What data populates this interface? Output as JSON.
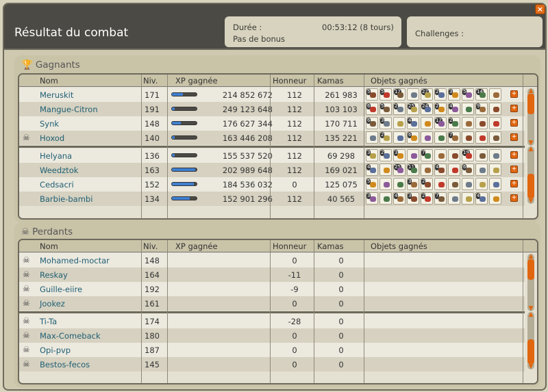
{
  "window": {
    "title": "Résultat du combat",
    "close_icon": "close-icon"
  },
  "info": {
    "duree_label": "Durée :",
    "duree_value": "00:53:12 (8 tours)",
    "bonus": "Pas de bonus",
    "challenges_label": "Challenges :"
  },
  "columns": {
    "nom": "Nom",
    "niv": "Niv.",
    "xp": "XP gagnée",
    "honneur": "Honneur",
    "kamas": "Kamas",
    "objets": "Objets gagnés"
  },
  "winners": {
    "title": "Gagnants",
    "rows": [
      {
        "name": "Meruskit",
        "level": "171",
        "xp": "214 852 672",
        "xp_fill": 0.45,
        "honneur": "112",
        "kamas": "261 983",
        "dead": false
      },
      {
        "name": "Mangue-Citron",
        "level": "191",
        "xp": "249 123 648",
        "xp_fill": 0.1,
        "honneur": "112",
        "kamas": "103 103",
        "dead": false
      },
      {
        "name": "Synk",
        "level": "148",
        "xp": "176 627 344",
        "xp_fill": 0.35,
        "honneur": "112",
        "kamas": "170 711",
        "dead": false
      },
      {
        "name": "Hoxod",
        "level": "140",
        "xp": "163 446 208",
        "xp_fill": 0.12,
        "honneur": "112",
        "kamas": "135 221",
        "dead": true
      },
      {
        "name": "Helyana",
        "level": "136",
        "xp": "155 537 520",
        "xp_fill": 0.12,
        "honneur": "112",
        "kamas": "69 298",
        "dead": false
      },
      {
        "name": "Weedztok",
        "level": "163",
        "xp": "202 989 648",
        "xp_fill": 0.95,
        "honneur": "112",
        "kamas": "169 021",
        "dead": false
      },
      {
        "name": "Cedsacri",
        "level": "152",
        "xp": "184 536 032",
        "xp_fill": 0.9,
        "honneur": "0",
        "kamas": "125 075",
        "dead": false
      },
      {
        "name": "Barbie-bambi",
        "level": "134",
        "xp": "152 901 296",
        "xp_fill": 0.72,
        "honneur": "112",
        "kamas": "40 565",
        "dead": false
      }
    ]
  },
  "losers": {
    "title": "Perdants",
    "rows": [
      {
        "name": "Mohamed-moctar",
        "level": "148",
        "honneur": "0",
        "kamas": "0"
      },
      {
        "name": "Reskay",
        "level": "164",
        "honneur": "-11",
        "kamas": "0"
      },
      {
        "name": "Guille-eiire",
        "level": "192",
        "honneur": "-9",
        "kamas": "0"
      },
      {
        "name": "Jookez",
        "level": "161",
        "honneur": "0",
        "kamas": "0"
      },
      {
        "name": "Ti-Ta",
        "level": "174",
        "honneur": "-28",
        "kamas": "0"
      },
      {
        "name": "Max-Comeback",
        "level": "180",
        "honneur": "0",
        "kamas": "0"
      },
      {
        "name": "Opi-pvp",
        "level": "187",
        "honneur": "0",
        "kamas": "0"
      },
      {
        "name": "Bestos-fecos",
        "level": "145",
        "honneur": "0",
        "kamas": "0"
      }
    ]
  },
  "item_badges": [
    [
      "5",
      "5",
      "12",
      "",
      "22",
      "2",
      "3",
      "5",
      "14",
      ""
    ],
    [
      "6",
      "5",
      "2",
      "25",
      "24",
      "2",
      "4",
      "",
      "9",
      ""
    ],
    [
      "6",
      "3",
      "",
      "4",
      "",
      "12",
      "2",
      "",
      "",
      ""
    ],
    [
      "",
      "2",
      "",
      "6",
      "",
      "",
      "7",
      "",
      "",
      ""
    ],
    [
      "3",
      "2",
      "3",
      "",
      "7",
      "",
      "",
      "19",
      "",
      ""
    ],
    [
      "4",
      "",
      "25",
      "11",
      "",
      "4",
      "",
      "6",
      "",
      ""
    ],
    [
      "5",
      "",
      "",
      "3",
      "2",
      "",
      "",
      "",
      "",
      ""
    ],
    [
      "3",
      "",
      "4",
      "3",
      "2",
      "7",
      "",
      "",
      "4",
      ""
    ]
  ],
  "colors": {
    "accent": "#e0660f",
    "header": "#4b4a44",
    "name": "#1f5f74",
    "xp_bar": "#3f7fd0"
  }
}
